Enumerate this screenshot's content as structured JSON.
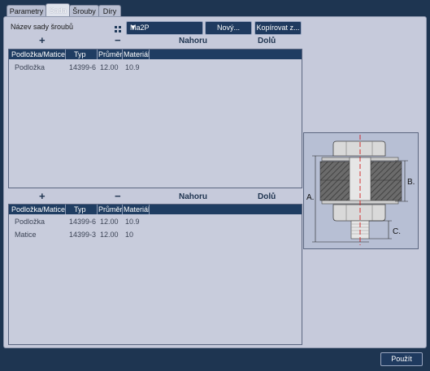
{
  "tabs": [
    {
      "label": "Parametry",
      "active": false
    },
    {
      "label": "Sada",
      "active": true
    },
    {
      "label": "Šrouby",
      "active": false
    },
    {
      "label": "Díry",
      "active": false
    }
  ],
  "set_name_label": "Název sady šroubů",
  "set_select_value": "Ma2P",
  "new_button": "Nový...",
  "copy_button": "Kopírovat z...",
  "top_toolbar": {
    "add": "+",
    "remove": "−",
    "up": "Nahoru",
    "down": "Dolů"
  },
  "bottom_toolbar": {
    "add": "+",
    "remove": "−",
    "up": "Nahoru",
    "down": "Dolů"
  },
  "columns": [
    "Podložka/Matice",
    "Typ",
    "Průměr",
    "Materiál"
  ],
  "top_rows": [
    [
      "Podložka",
      "14399-6",
      "12.00",
      "10.9"
    ]
  ],
  "bottom_rows": [
    [
      "Podložka",
      "14399-6",
      "12.00",
      "10.9"
    ],
    [
      "Matice",
      "14399-3",
      "12.00",
      "10"
    ]
  ],
  "diagram_labels": {
    "a": "A.",
    "b": "B.",
    "c": "C."
  },
  "apply_button": "Použít",
  "colors": {
    "accent": "#1f3d62",
    "panel": "#c6cadb",
    "background": "#1e3551",
    "centerline": "#d21e1e"
  }
}
